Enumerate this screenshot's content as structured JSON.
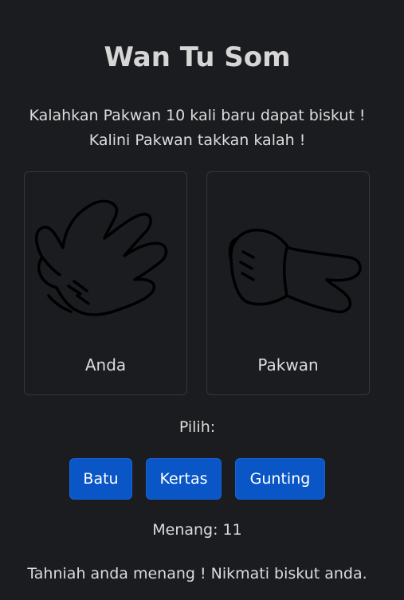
{
  "header": {
    "title": "Wan Tu Som",
    "line1": "Kalahkan Pakwan 10 kali baru dapat biskut !",
    "line2": "Kalini Pakwan takkan kalah !"
  },
  "player": {
    "label": "Anda",
    "hand_icon": "open-hand-paper-icon"
  },
  "opponent": {
    "label": "Pakwan",
    "hand_icon": "scissors-hand-icon"
  },
  "controls": {
    "prompt": "Pilih:",
    "rock": "Batu",
    "paper": "Kertas",
    "scissors": "Gunting"
  },
  "score": {
    "wins_text": "Menang: 11"
  },
  "result": {
    "message": "Tahniah anda menang ! Nikmati biskut anda."
  },
  "colors": {
    "background": "#1b1c1f",
    "button": "#0a56c7",
    "text": "#dcdcdc"
  }
}
